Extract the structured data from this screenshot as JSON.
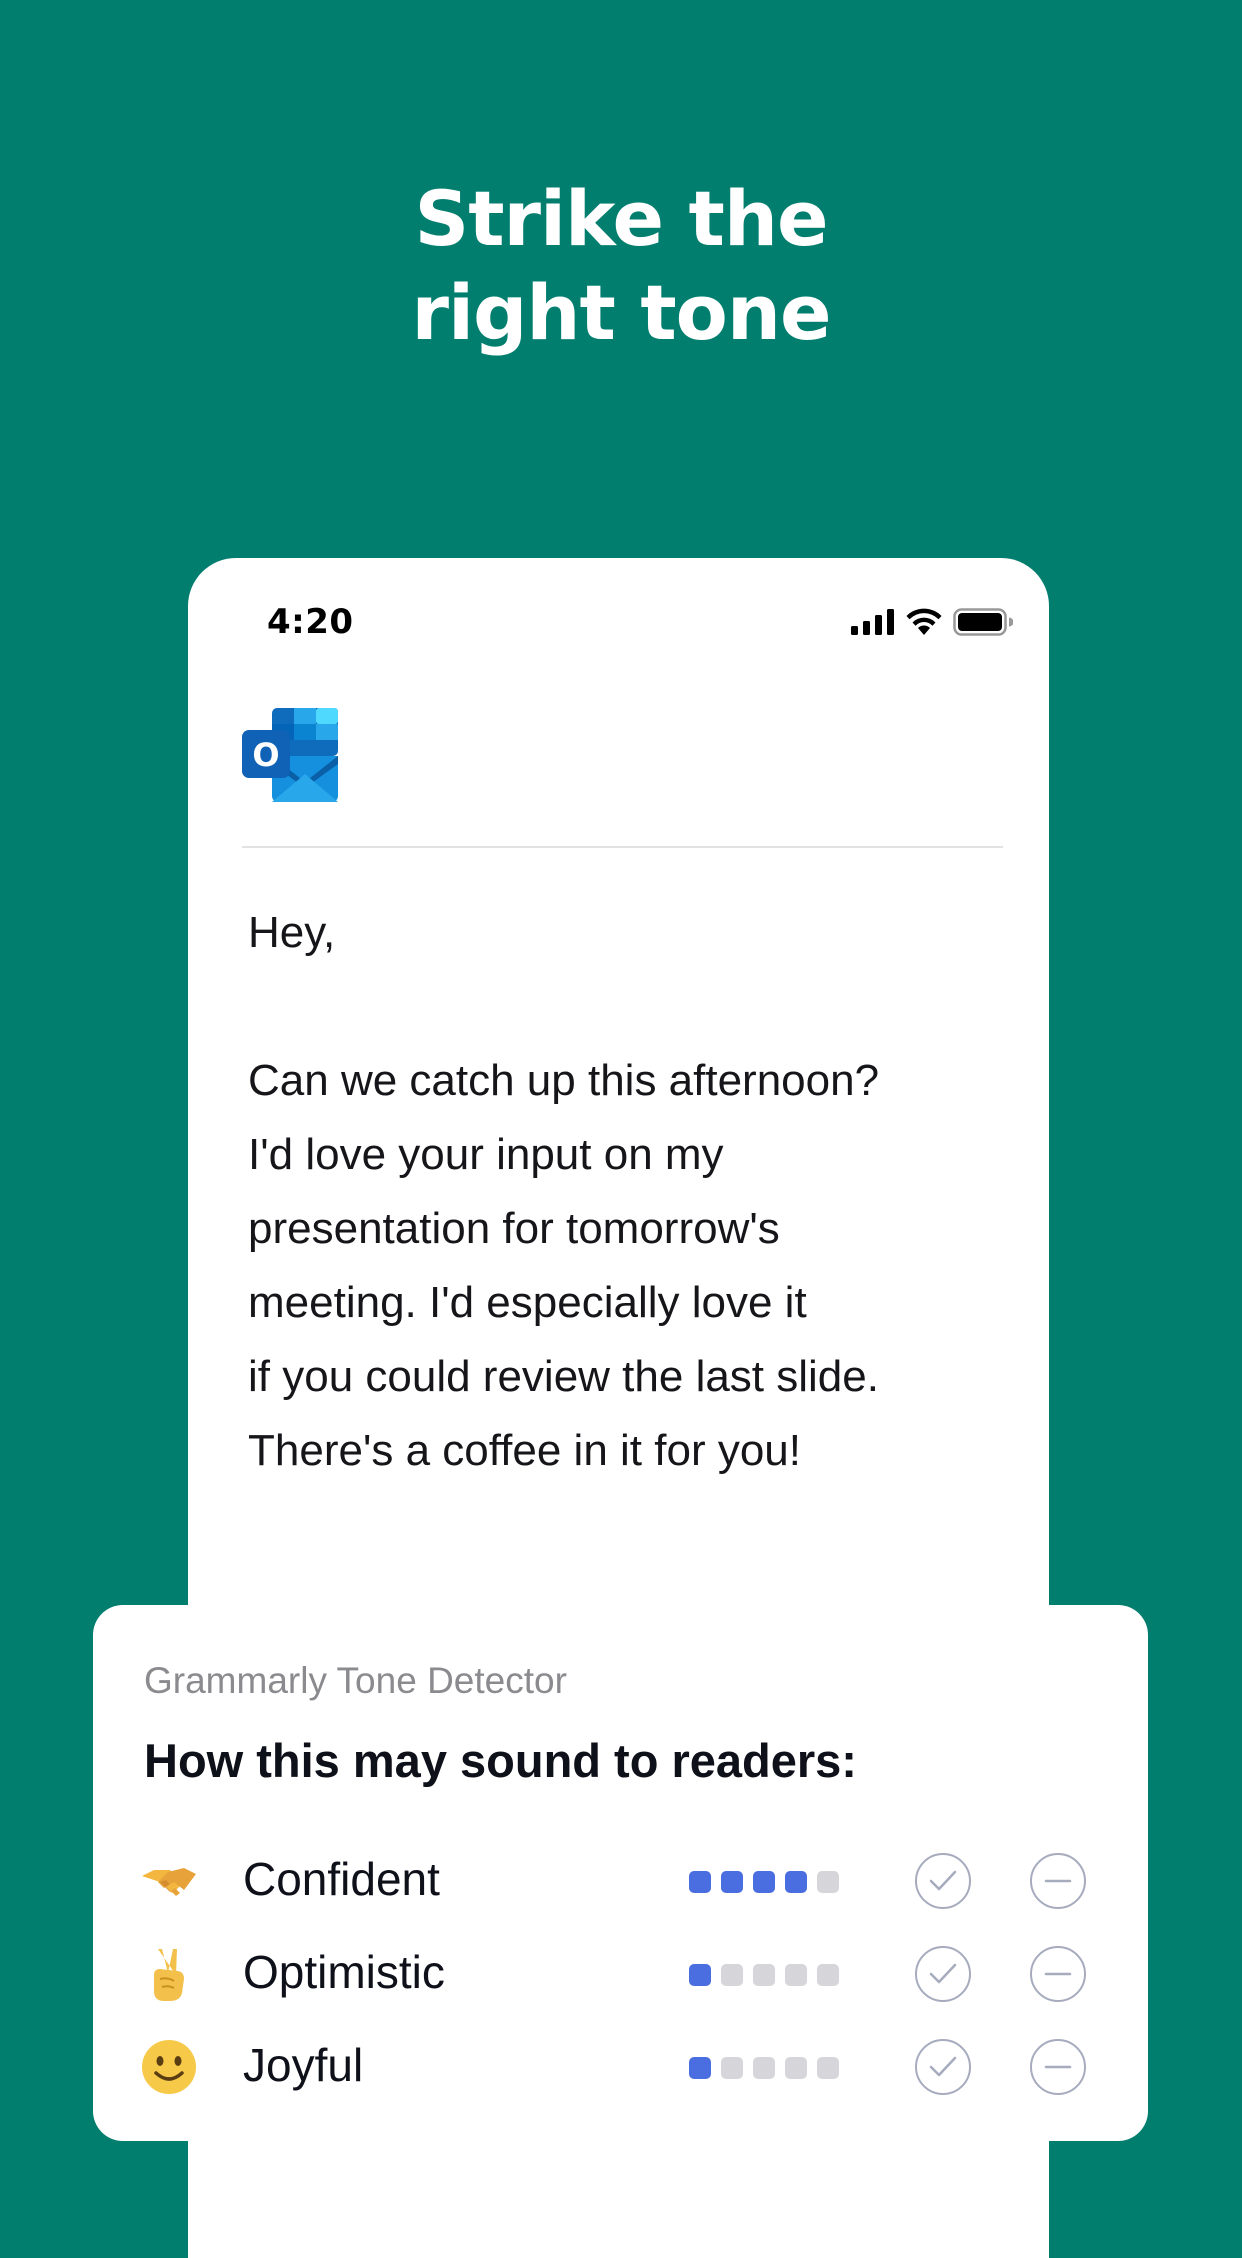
{
  "headline": {
    "line1": "Strike the",
    "line2": "right tone"
  },
  "status_bar": {
    "time": "4:20",
    "icons": [
      "signal-icon",
      "wifi-icon",
      "battery-icon"
    ]
  },
  "app": {
    "icon": "outlook-icon",
    "logo_letter": "O"
  },
  "email": {
    "greeting": "Hey,",
    "lines": [
      "Can we catch up this afternoon?",
      "I'd love your input on my",
      "presentation for tomorrow's",
      "meeting. I'd especially love it",
      "if you could review the last slide.",
      "There's a coffee in it for you!"
    ]
  },
  "tone_detector": {
    "source": "Grammarly Tone Detector",
    "heading": "How this may sound to readers:",
    "tones": [
      {
        "emoji": "handshake-emoji",
        "label": "Confident",
        "level": 4,
        "max": 5
      },
      {
        "emoji": "victory-hand-emoji",
        "label": "Optimistic",
        "level": 1,
        "max": 5
      },
      {
        "emoji": "smiling-face-emoji",
        "label": "Joyful",
        "level": 1,
        "max": 5
      }
    ]
  },
  "colors": {
    "background": "#027e6f",
    "meter_active": "#4a6ee0",
    "meter_inactive": "#d6d6da",
    "action_outline": "#a6abbe"
  }
}
